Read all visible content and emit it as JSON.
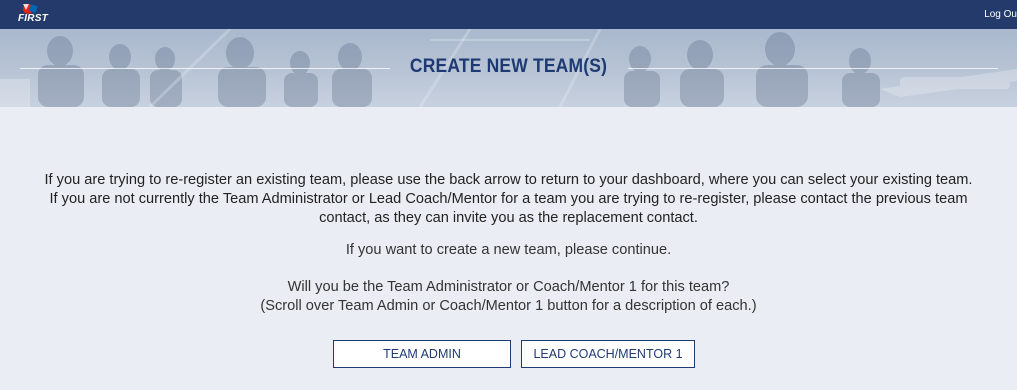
{
  "topbar": {
    "logo_text": "FIRST",
    "logout_label": "Log Ou"
  },
  "banner": {
    "title": "CREATE NEW TEAM(S)"
  },
  "main": {
    "intro": "If you are trying to re-register an existing team, please use the back arrow to return to your dashboard, where you can select your existing team. If you are not currently the Team Administrator or Lead Coach/Mentor for a team you are trying to re-register, please contact the previous team contact, as they can invite you as the replacement contact.",
    "continue_text": "If you want to create a new team, please continue.",
    "question_line1": "Will you be the Team Administrator or Coach/Mentor 1 for this team?",
    "question_line2": "(Scroll over Team Admin or Coach/Mentor 1 button for a description of each.)",
    "buttons": {
      "team_admin": "TEAM ADMIN",
      "lead_coach": "LEAD COACH/MENTOR 1"
    }
  },
  "colors": {
    "nav_bg": "#233a6b",
    "title_color": "#1e3a72",
    "content_bg": "#eaedf3",
    "logo_red": "#e2231a",
    "logo_blue": "#0066b3"
  },
  "icons": {
    "logo": "first-logo-icon"
  }
}
